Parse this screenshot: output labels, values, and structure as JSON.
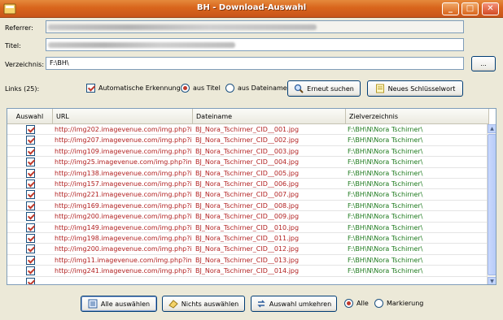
{
  "window": {
    "title": "BH - Download-Auswahl",
    "minimize_glyph": "_",
    "maximize_glyph": "□",
    "close_glyph": "✕"
  },
  "form": {
    "referrer_label": "Referrer:",
    "titel_label": "Titel:",
    "verzeichnis_label": "Verzeichnis:",
    "verzeichnis_value": "F:\\BH\\",
    "browse_label": "...",
    "links_label": "Links (25):",
    "auto_erkennung_label": "Automatische Erkennung",
    "aus_titel_label": "aus Titel",
    "aus_dateiname_label": "aus Dateiname",
    "erneut_suchen_label": "Erneut suchen",
    "neues_schluesselwort_label": "Neues Schlüsselwort"
  },
  "table": {
    "headers": [
      "Auswahl",
      "URL",
      "Dateiname",
      "Zielverzeichnis"
    ],
    "rows": [
      {
        "url": "http://img202.imagevenue.com/img.php?i...",
        "file": "BJ_Nora_Tschirner_CID__001.jpg",
        "dir": "F:\\BH\\N\\Nora Tschirner\\"
      },
      {
        "url": "http://img207.imagevenue.com/img.php?i...",
        "file": "BJ_Nora_Tschirner_CID__002.jpg",
        "dir": "F:\\BH\\N\\Nora Tschirner\\"
      },
      {
        "url": "http://img109.imagevenue.com/img.php?i...",
        "file": "BJ_Nora_Tschirner_CID__003.jpg",
        "dir": "F:\\BH\\N\\Nora Tschirner\\"
      },
      {
        "url": "http://img25.imagevenue.com/img.php?im...",
        "file": "BJ_Nora_Tschirner_CID__004.jpg",
        "dir": "F:\\BH\\N\\Nora Tschirner\\"
      },
      {
        "url": "http://img138.imagevenue.com/img.php?i...",
        "file": "BJ_Nora_Tschirner_CID__005.jpg",
        "dir": "F:\\BH\\N\\Nora Tschirner\\"
      },
      {
        "url": "http://img157.imagevenue.com/img.php?i...",
        "file": "BJ_Nora_Tschirner_CID__006.jpg",
        "dir": "F:\\BH\\N\\Nora Tschirner\\"
      },
      {
        "url": "http://img221.imagevenue.com/img.php?i...",
        "file": "BJ_Nora_Tschirner_CID__007.jpg",
        "dir": "F:\\BH\\N\\Nora Tschirner\\"
      },
      {
        "url": "http://img169.imagevenue.com/img.php?i...",
        "file": "BJ_Nora_Tschirner_CID__008.jpg",
        "dir": "F:\\BH\\N\\Nora Tschirner\\"
      },
      {
        "url": "http://img200.imagevenue.com/img.php?i...",
        "file": "BJ_Nora_Tschirner_CID__009.jpg",
        "dir": "F:\\BH\\N\\Nora Tschirner\\"
      },
      {
        "url": "http://img149.imagevenue.com/img.php?i...",
        "file": "BJ_Nora_Tschirner_CID__010.jpg",
        "dir": "F:\\BH\\N\\Nora Tschirner\\"
      },
      {
        "url": "http://img198.imagevenue.com/img.php?i...",
        "file": "BJ_Nora_Tschirner_CID__011.jpg",
        "dir": "F:\\BH\\N\\Nora Tschirner\\"
      },
      {
        "url": "http://img200.imagevenue.com/img.php?i...",
        "file": "BJ_Nora_Tschirner_CID__012.jpg",
        "dir": "F:\\BH\\N\\Nora Tschirner\\"
      },
      {
        "url": "http://img11.imagevenue.com/img.php?im...",
        "file": "BJ_Nora_Tschirner_CID__013.jpg",
        "dir": "F:\\BH\\N\\Nora Tschirner\\"
      },
      {
        "url": "http://img241.imagevenue.com/img.php?i...",
        "file": "BJ_Nora_Tschirner_CID__014.jpg",
        "dir": "F:\\BH\\N\\Nora Tschirner\\"
      },
      {
        "url": "",
        "file": "",
        "dir": ""
      }
    ]
  },
  "footer": {
    "alle_auswaehlen_label": "Alle auswählen",
    "nichts_auswaehlen_label": "Nichts auswählen",
    "auswahl_umkehren_label": "Auswahl umkehren",
    "alle_label": "Alle",
    "markierung_label": "Markierung"
  },
  "colors": {
    "titlebar": "#d9651c",
    "url_text": "#b22222",
    "dir_text": "#1d7a1d",
    "check_mark": "#c0392b"
  }
}
